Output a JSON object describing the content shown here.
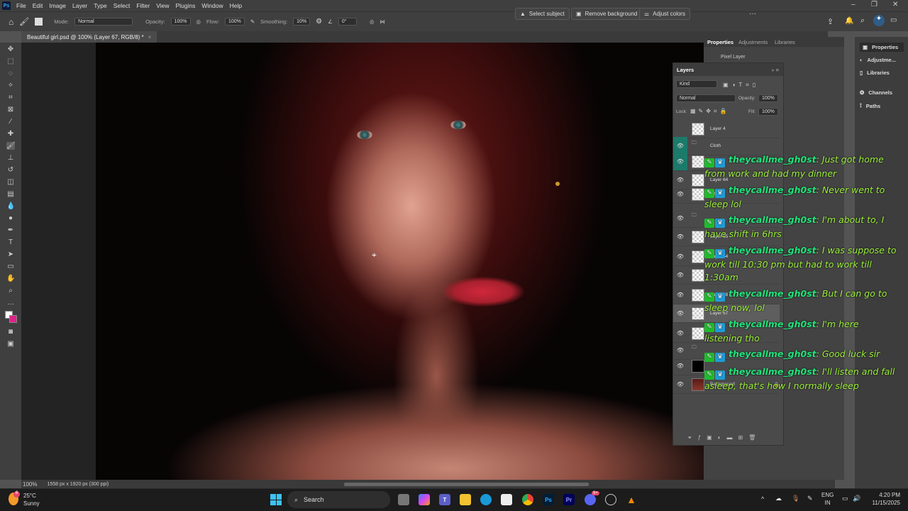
{
  "app": {
    "logo": "Ps",
    "menu": [
      "File",
      "Edit",
      "Image",
      "Layer",
      "Type",
      "Select",
      "Filter",
      "View",
      "Plugins",
      "Window",
      "Help"
    ]
  },
  "context_bar": {
    "select_subject": "Select subject",
    "remove_background": "Remove background",
    "adjust_colors": "Adjust colors",
    "more": "···"
  },
  "window_controls": {
    "minimize": "–",
    "restore": "❐",
    "close": "✕"
  },
  "options": {
    "mode_label": "Mode:",
    "mode_value": "Normal",
    "opacity_label": "Opacity:",
    "opacity_value": "100%",
    "flow_label": "Flow:",
    "flow_value": "100%",
    "smoothing_label": "Smoothing:",
    "smoothing_value": "10%",
    "angle_value": "0°"
  },
  "document": {
    "tab_title": "Beautiful girl.psd @ 100% (Layer 67, RGB/8) *",
    "zoom": "100%",
    "dimensions": "1558 px x 1920 px (300 ppi)"
  },
  "properties": {
    "tabs": [
      "Properties",
      "Adjustments",
      "Libraries"
    ],
    "type": "Pixel Layer"
  },
  "dock": {
    "items": [
      "Properties",
      "Adjustme...",
      "Libraries",
      "Channels",
      "Paths"
    ]
  },
  "layers": {
    "title": "Layers",
    "filter": "Kind",
    "blend_mode": "Normal",
    "opacity_label": "Opacity:",
    "opacity": "100%",
    "lock_label": "Lock:",
    "fill_label": "Fill:",
    "fill": "100%",
    "items": [
      {
        "name": "Layer 4",
        "visible": false
      },
      {
        "name": "Cloth",
        "group": true
      },
      {
        "name": "",
        "visible": true
      },
      {
        "name": "Layer 64"
      },
      {
        "name": "Effects"
      },
      {
        "name": "",
        "group": true
      },
      {
        "name": "Layer 55"
      },
      {
        "name": "Layer 54"
      },
      {
        "name": ""
      },
      {
        "name": "Layer 28"
      },
      {
        "name": "Layer 67",
        "selected": true
      },
      {
        "name": ""
      },
      {
        "name": "",
        "group": true
      },
      {
        "name": ""
      },
      {
        "name": "Background",
        "locked": true
      }
    ]
  },
  "chat": {
    "messages": [
      {
        "user": "theycallme_gh0st",
        "text": "Just got home from work and had my dinner"
      },
      {
        "user": "theycallme_gh0st",
        "text": "Never went to sleep lol"
      },
      {
        "user": "theycallme_gh0st",
        "text": "I'm about to, I have shift in 6hrs"
      },
      {
        "user": "theycallme_gh0st",
        "text": "I was suppose to work till 10:30 pm but had to work till 1:30am"
      },
      {
        "user": "theycallme_gh0st",
        "text": "But I can go to sleep now, lol"
      },
      {
        "user": "theycallme_gh0st",
        "text": "I'm here listening tho"
      },
      {
        "user": "theycallme_gh0st",
        "text": "Good luck sir"
      },
      {
        "user": "theycallme_gh0st",
        "text": "I'll listen and fall asleep, that's how I normally sleep"
      }
    ]
  },
  "taskbar": {
    "weather_temp": "25°C",
    "weather_desc": "Sunny",
    "weather_badge": "6",
    "search": "Search",
    "discord_badge": "9+",
    "lang": "ENG",
    "region": "IN",
    "time": "4:20 PM",
    "date": "11/15/2025"
  }
}
